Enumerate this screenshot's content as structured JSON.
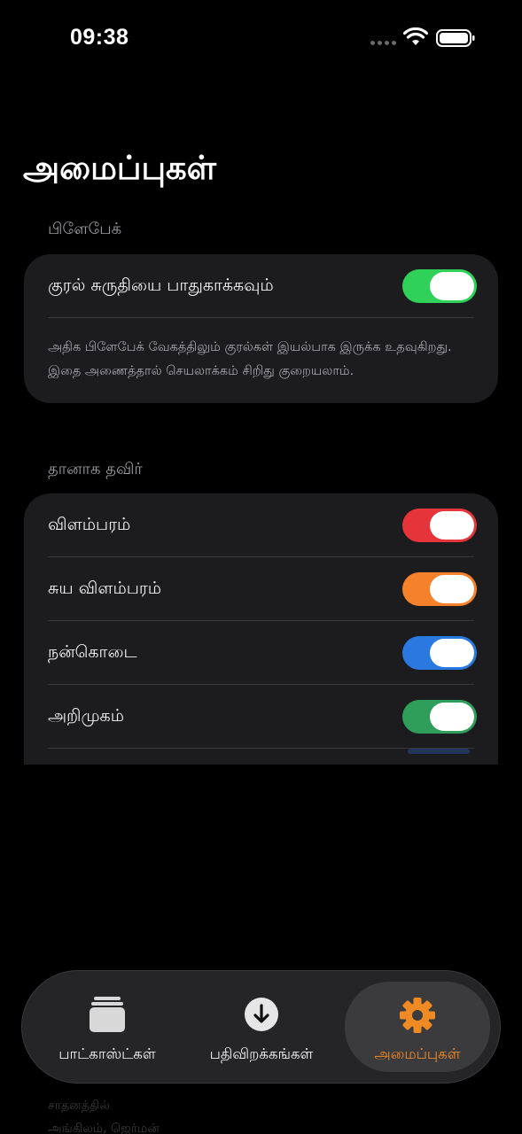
{
  "status_bar": {
    "time": "09:38"
  },
  "page": {
    "title": "அமைப்புகள்"
  },
  "playback": {
    "section_title": "பிளேபேக்",
    "items": [
      {
        "label": "குரல் சுருதியை பாதுகாக்கவும்",
        "on": true,
        "color": "#30d158"
      }
    ],
    "description": "அதிக பிளேபேக் வேகத்திலும் குரல்கள் இயல்பாக இருக்க உதவுகிறது. இதை அணைத்தால் செயலாக்கம் சிறிது குறையலாம்."
  },
  "auto_skip": {
    "section_title": "தானாக தவிர்",
    "items": [
      {
        "label": "விளம்பரம்",
        "on": true,
        "color": "#e5343a"
      },
      {
        "label": "சுய விளம்பரம்",
        "on": true,
        "color": "#f5822a"
      },
      {
        "label": "நன்கொடை",
        "on": true,
        "color": "#2a79e0"
      },
      {
        "label": "அறிமுகம்",
        "on": true,
        "color": "#2f9e5a"
      }
    ]
  },
  "background_text": {
    "line1": "சாதனத்தில்",
    "line2": "அங்கிலம், ஜெர்மன்"
  },
  "tab_bar": {
    "tabs": [
      {
        "label": "பாட்காஸ்ட்கள்",
        "icon": "podcasts-stack-icon",
        "active": false
      },
      {
        "label": "பதிவிறக்கங்கள்",
        "icon": "download-arrow-icon",
        "active": false
      },
      {
        "label": "அமைப்புகள்",
        "icon": "gear-icon",
        "active": true
      }
    ],
    "accent_color": "#f08a24"
  }
}
